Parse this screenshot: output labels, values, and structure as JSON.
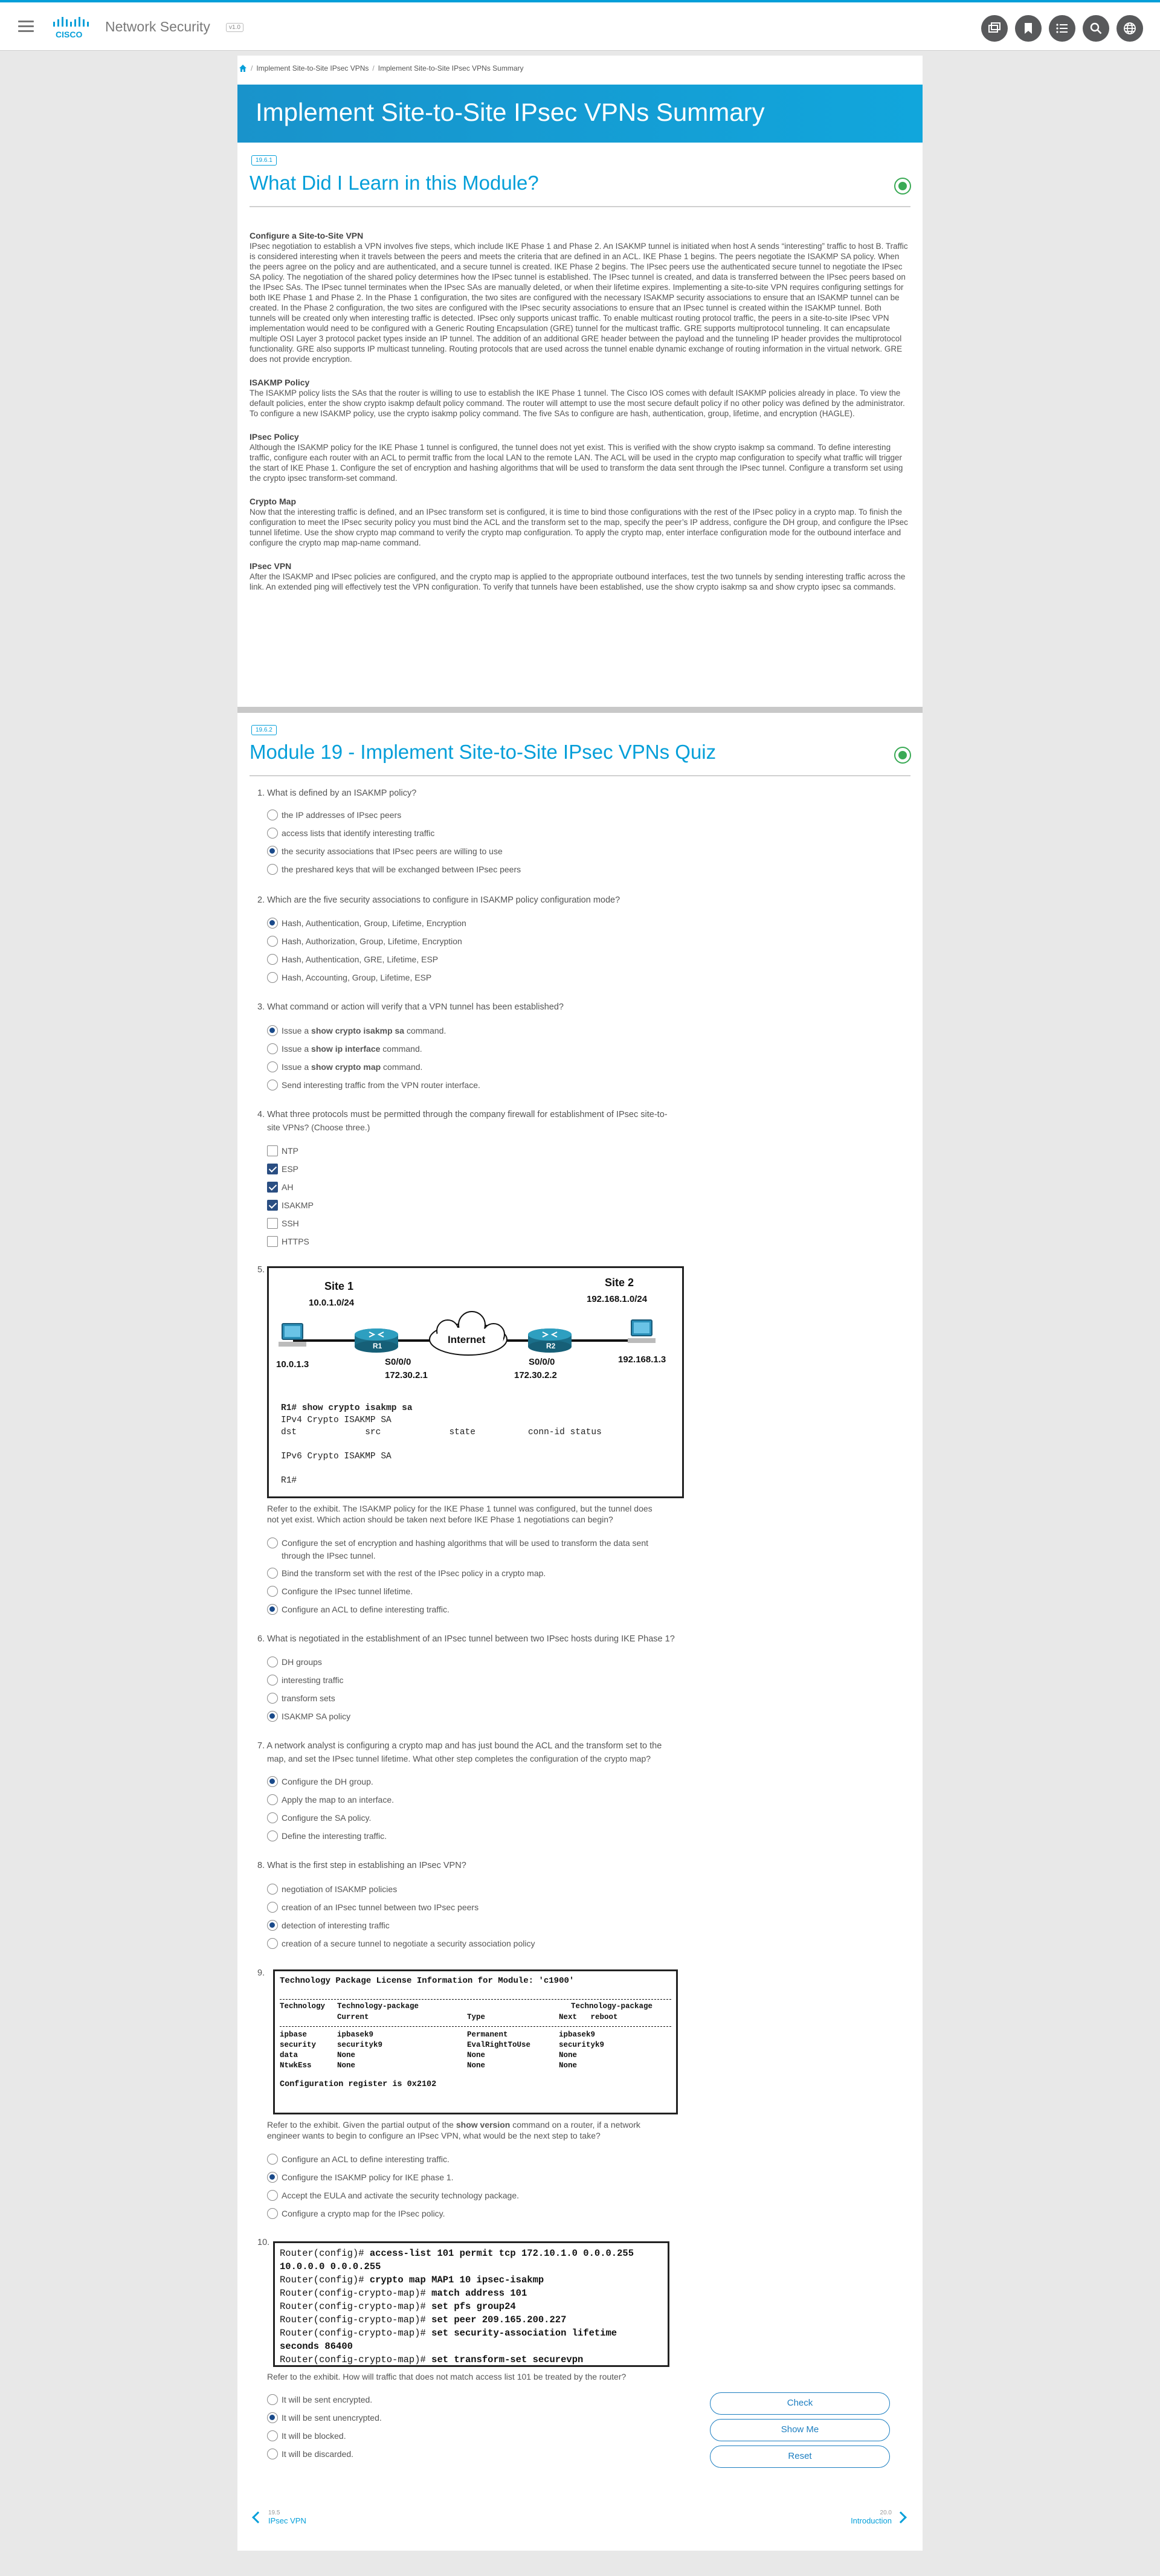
{
  "app": {
    "title": "Network Security",
    "version": "v1.0"
  },
  "header_icons": [
    "window-icon",
    "bookmark-icon",
    "menu-list-icon",
    "search-icon",
    "globe-icon"
  ],
  "breadcrumb": [
    "Implement Site-to-Site IPsec VPNs",
    "Implement Site-to-Site IPsec VPNs Summary"
  ],
  "banner": {
    "title": "Implement Site-to-Site IPsec VPNs Summary"
  },
  "section1": {
    "badge": "19.6.1",
    "title": "What Did I Learn in this Module?"
  },
  "summary": [
    {
      "heading": "Configure a Site-to-Site VPN",
      "body": "IPsec negotiation to establish a VPN involves five steps, which include IKE Phase 1 and Phase 2. An ISAKMP tunnel is initiated when host A sends “interesting” traffic to host B. Traffic is considered interesting when it travels between the peers and meets the criteria that are defined in an ACL. IKE Phase 1 begins. The peers negotiate the ISAKMP SA policy. When the peers agree on the policy and are authenticated, and a secure tunnel is created. IKE Phase 2 begins. The IPsec peers use the authenticated secure tunnel to negotiate the IPsec SA policy. The negotiation of the shared policy determines how the IPsec tunnel is established. The IPsec tunnel is created, and data is transferred between the IPsec peers based on the IPsec SAs. The IPsec tunnel terminates when the IPsec SAs are manually deleted, or when their lifetime expires. Implementing a site-to-site VPN requires configuring settings for both IKE Phase 1 and Phase 2. In the Phase 1 configuration, the two sites are configured with the necessary ISAKMP security associations to ensure that an ISAKMP tunnel can be created. In the Phase 2 configuration, the two sites are configured with the IPsec security associations to ensure that an IPsec tunnel is created within the ISAKMP tunnel. Both tunnels will be created only when interesting traffic is detected. IPsec only supports unicast traffic. To enable multicast routing protocol traffic, the peers in a site-to-site IPsec VPN implementation would need to be configured with a Generic Routing Encapsulation (GRE) tunnel for the multicast traffic. GRE supports multiprotocol tunneling. It can encapsulate multiple OSI Layer 3 protocol packet types inside an IP tunnel. The addition of an additional GRE header between the payload and the tunneling IP header provides the multiprotocol functionality. GRE also supports IP multicast tunneling. Routing protocols that are used across the tunnel enable dynamic exchange of routing information in the virtual network. GRE does not provide encryption."
    },
    {
      "heading": "ISAKMP Policy",
      "body": "The ISAKMP policy lists the SAs that the router is willing to use to establish the IKE Phase 1 tunnel. The Cisco IOS comes with default ISAKMP policies already in place. To view the default policies, enter the show crypto isakmp default policy command. The router will attempt to use the most secure default policy if no other policy was defined by the administrator. To configure a new ISAKMP policy, use the crypto isakmp policy command. The five SAs to configure are hash, authentication, group, lifetime, and encryption (HAGLE)."
    },
    {
      "heading": "IPsec Policy",
      "body": "Although the ISAKMP policy for the IKE Phase 1 tunnel is configured, the tunnel does not yet exist. This is verified with the show crypto isakmp sa command. To define interesting traffic, configure each router with an ACL to permit traffic from the local LAN to the remote LAN. The ACL will be used in the crypto map configuration to specify what traffic will trigger the start of IKE Phase 1. Configure the set of encryption and hashing algorithms that will be used to transform the data sent through the IPsec tunnel. Configure a transform set using the crypto ipsec transform-set command."
    },
    {
      "heading": "Crypto Map",
      "body": "Now that the interesting traffic is defined, and an IPsec transform set is configured, it is time to bind those configurations with the rest of the IPsec policy in a crypto map. To finish the configuration to meet the IPsec security policy you must bind the ACL and the transform set to the map, specify the peer’s IP address, configure the DH group, and configure the IPsec tunnel lifetime. Use the show crypto map command to verify the crypto map configuration. To apply the crypto map, enter interface configuration mode for the outbound interface and configure the crypto map map-name command."
    },
    {
      "heading": "IPsec VPN",
      "body": "After the ISAKMP and IPsec policies are configured, and the crypto map is applied to the appropriate outbound interfaces, test the two tunnels by sending interesting traffic across the link. An extended ping will effectively test the VPN configuration. To verify that tunnels have been established, use the show crypto isakmp sa and show crypto ipsec sa commands."
    }
  ],
  "section2": {
    "badge": "19.6.2",
    "title": "Module 19 - Implement Site-to-Site IPsec VPNs Quiz"
  },
  "quiz": [
    {
      "num": "1.",
      "text": "What is defined by an ISAKMP policy?",
      "options": [
        "the IP addresses of IPsec peers",
        "access lists that identify interesting traffic",
        "the security associations that IPsec peers are willing to use",
        "the preshared keys that will be exchanged between IPsec peers"
      ]
    },
    {
      "num": "2.",
      "text": "Which are the five security associations to configure in ISAKMP policy configuration mode?",
      "options": [
        "Hash, Authentication, Group, Lifetime, Encryption",
        "Hash, Authorization, Group, Lifetime, Encryption",
        "Hash, Authentication, GRE, Lifetime, ESP",
        "Hash, Accounting, Group, Lifetime, ESP"
      ]
    },
    {
      "num": "3.",
      "text": "What command or action will verify that a VPN tunnel has been established?",
      "options": [
        "Issue a show crypto isakmp sa command.",
        "Issue a show ip interface command.",
        "Issue a show crypto map command.",
        "Send interesting traffic from the VPN router interface."
      ]
    },
    {
      "num": "4.",
      "text1": "What three protocols must be permitted through the company firewall for establishment of IPsec site-to-",
      "text2": "site VPNs? (Choose three.)",
      "options": [
        "NTP",
        "ESP",
        "AH",
        "ISAKMP",
        "SSH",
        "HTTPS"
      ]
    },
    {
      "num": "5.",
      "text1": "Refer to the exhibit. The ISAKMP policy for the IKE Phase 1 tunnel was configured, but the tunnel does",
      "text2": "not yet exist. Which action should be taken next before IKE Phase 1 negotiations can begin?",
      "options": [
        "Configure the set of encryption and hashing algorithms that will be used to transform the data sent",
        "through the IPsec tunnel.",
        "Bind the transform set with the rest of the IPsec policy in a crypto map.",
        "Configure the IPsec tunnel lifetime.",
        "Configure an ACL to define interesting traffic."
      ]
    },
    {
      "num": "6.",
      "text": "What is negotiated in the establishment of an IPsec tunnel between two IPsec hosts during IKE Phase 1?",
      "options": [
        "DH groups",
        "interesting traffic",
        "transform sets",
        "ISAKMP SA policy"
      ]
    },
    {
      "num": "7.",
      "text1": "A network analyst is configuring a crypto map and has just bound the ACL and the transform set to the",
      "text2": "map, and set the IPsec tunnel lifetime. What other step completes the configuration of the crypto map?",
      "options": [
        "Configure the DH group.",
        "Apply the map to an interface.",
        "Configure the SA policy.",
        "Define the interesting traffic."
      ]
    },
    {
      "num": "8.",
      "text": "What is the first step in establishing an IPsec VPN?",
      "options": [
        "negotiation of ISAKMP policies",
        "creation of an IPsec tunnel between two IPsec peers",
        "detection of interesting traffic",
        "creation of a secure tunnel to negotiate a security association policy"
      ]
    },
    {
      "num": "9.",
      "text1": "Refer to the exhibit. Given the partial output of the show version command on a router, if a network",
      "text2": "engineer wants to begin to configure an IPsec VPN, what would be the next step to take?",
      "options": [
        "Configure an ACL to define interesting traffic.",
        "Configure the ISAKMP policy for IKE phase 1.",
        "Accept the EULA and activate the security technology package.",
        "Configure a crypto map for the IPsec policy."
      ]
    },
    {
      "num": "10.",
      "text": "Refer to the exhibit. How will traffic that does not match access list 101 be treated by the router?",
      "options": [
        "It will be sent encrypted.",
        "It will be sent unencrypted.",
        "It will be blocked.",
        "It will be discarded."
      ]
    }
  ],
  "exhibit5": {
    "site1": "Site 1",
    "site1_net": "10.0.1.0/24",
    "site2": "Site 2",
    "site2_net": "192.168.1.0/24",
    "internet": "Internet",
    "r1": "R1",
    "r2": "R2",
    "r1_if": "S0/0/0",
    "r1_ip": "172.30.2.1",
    "r2_if": "S0/0/0",
    "r2_ip": "172.30.2.2",
    "pc1": "10.0.1.3",
    "pc2": "192.168.1.3",
    "cli": [
      "R1# show crypto isakmp sa",
      "IPv4 Crypto ISAKMP SA",
      "dst             src             state          conn-id status",
      "",
      "IPv6 Crypto ISAKMP SA",
      "",
      "R1#"
    ]
  },
  "exhibit9": {
    "title": "Technology Package License Information for Module: 'c1900'",
    "h1": [
      "Technology",
      "Technology-package",
      "",
      "Technology-package"
    ],
    "h2": [
      "",
      "Current",
      "Type",
      "Next   reboot"
    ],
    "rows": [
      [
        "ipbase",
        "ipbasek9",
        "Permanent",
        "ipbasek9"
      ],
      [
        "security",
        "securityk9",
        "EvalRightToUse",
        "securityk9"
      ],
      [
        "data",
        "None",
        "None",
        "None"
      ],
      [
        "NtwkEss",
        "None",
        "None",
        "None"
      ]
    ],
    "footer": "Configuration register is 0x2102"
  },
  "exhibit10": {
    "lines": [
      [
        "Router(config)# ",
        "access-list 101 permit tcp 172.10.1.0 0.0.0.255"
      ],
      [
        "",
        "10.0.0.0 0.0.0.255"
      ],
      [
        "Router(config)# ",
        "crypto map MAP1 10 ipsec-isakmp"
      ],
      [
        "Router(config-crypto-map)# ",
        "match address 101"
      ],
      [
        "Router(config-crypto-map)# ",
        "set pfs group24"
      ],
      [
        "Router(config-crypto-map)# ",
        "set peer 209.165.200.227"
      ],
      [
        "Router(config-crypto-map)# ",
        "set security-association lifetime"
      ],
      [
        "",
        "seconds 86400"
      ],
      [
        "Router(config-crypto-map)# ",
        "set transform-set securevpn"
      ]
    ]
  },
  "buttons": {
    "check": "Check",
    "show_me": "Show Me",
    "reset": "Reset"
  },
  "footer_nav": {
    "prev_num": "19.5",
    "prev_label": "IPsec VPN",
    "next_num": "20.0",
    "next_label": "Introduction"
  },
  "colors": {
    "accent": "#049fd9",
    "selected": "#1a4a8a"
  }
}
